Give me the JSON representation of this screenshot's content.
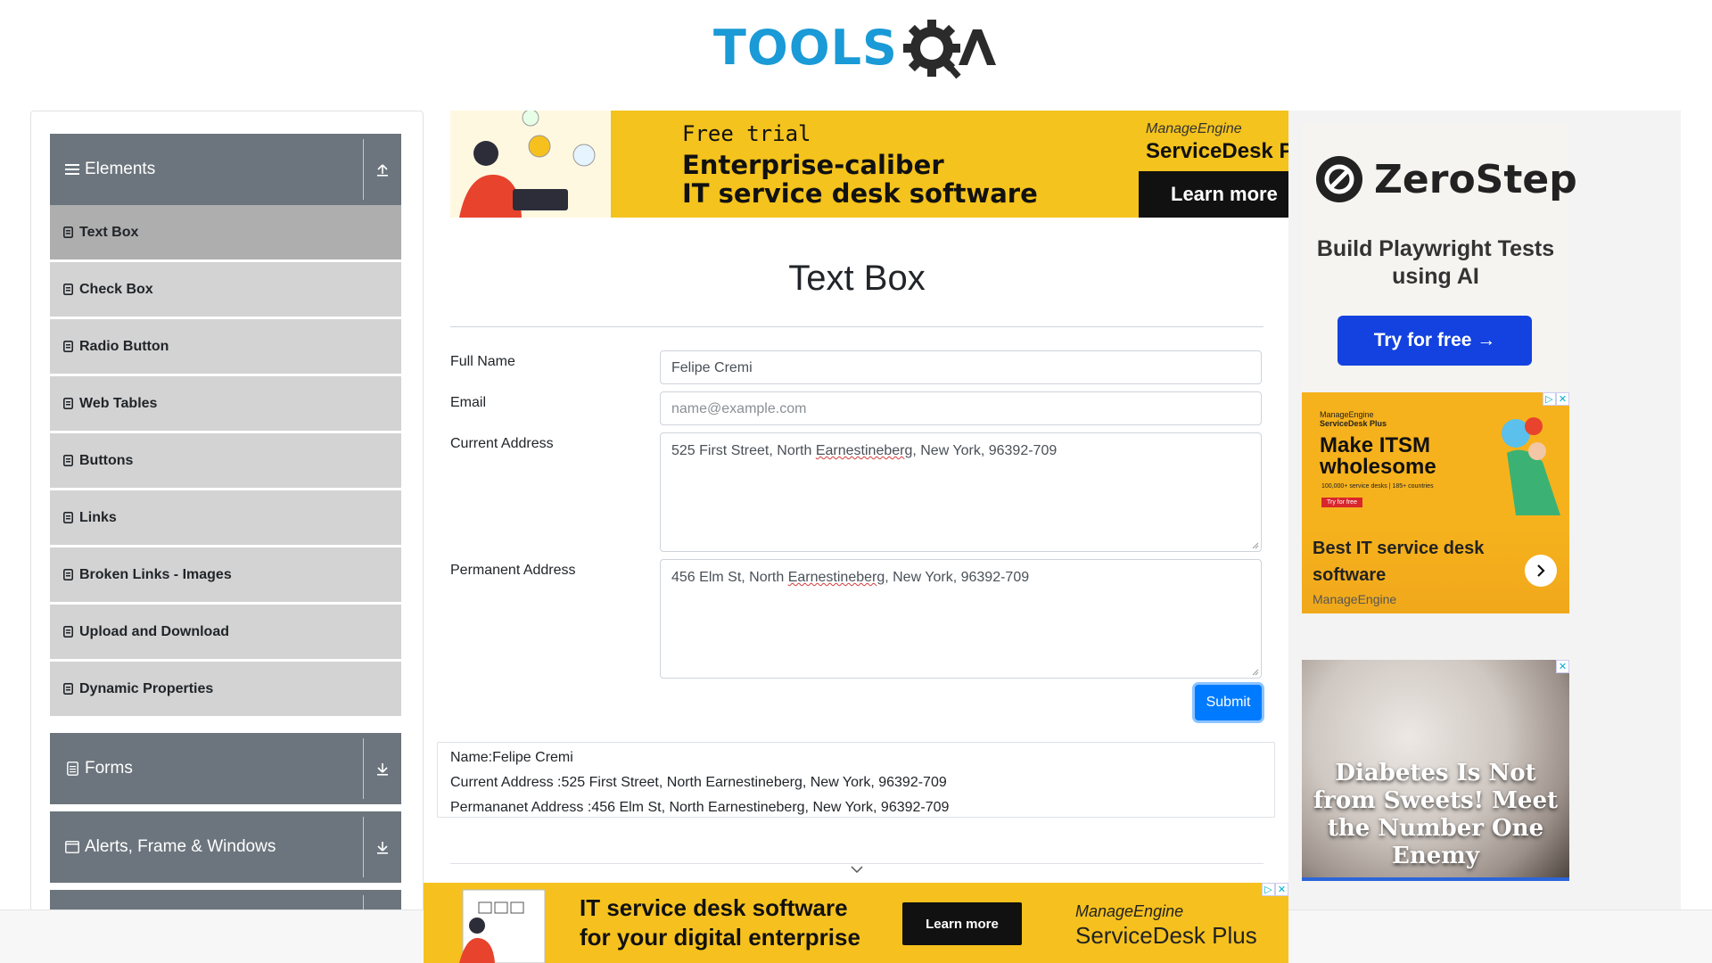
{
  "header": {
    "logo_text_part1": "TOOLS",
    "logo_text_part2": "QA"
  },
  "sidebar": {
    "groups": [
      {
        "label": "Elements",
        "icon": "hamburger-icon",
        "expanded": true
      },
      {
        "label": "Forms",
        "icon": "document-icon",
        "expanded": false
      },
      {
        "label": "Alerts, Frame & Windows",
        "icon": "window-icon",
        "expanded": false
      }
    ],
    "items": [
      {
        "label": "Text Box",
        "active": true
      },
      {
        "label": "Check Box"
      },
      {
        "label": "Radio Button"
      },
      {
        "label": "Web Tables"
      },
      {
        "label": "Buttons"
      },
      {
        "label": "Links"
      },
      {
        "label": "Broken Links - Images"
      },
      {
        "label": "Upload and Download"
      },
      {
        "label": "Dynamic Properties"
      }
    ]
  },
  "top_ad": {
    "line1": "Free trial",
    "line2": "Enterprise-caliber",
    "line3": "IT service desk software",
    "brand_small": "ManageEngine",
    "brand_large": "ServiceDesk Plus",
    "cta": "Learn more"
  },
  "main": {
    "title": "Text Box",
    "fields": {
      "full_name_label": "Full Name",
      "full_name_value": "Felipe Cremi",
      "email_label": "Email",
      "email_placeholder": "name@example.com",
      "current_address_label": "Current Address",
      "current_address_pre": "525 First Street, North ",
      "current_address_word": "Earnestineberg",
      "current_address_post": ", New York, 96392-709",
      "permanent_address_label": "Permanent Address",
      "permanent_address_pre": "456 Elm St, North ",
      "permanent_address_word": "Earnestineberg",
      "permanent_address_post": ", New York, 96392-709"
    },
    "submit_label": "Submit",
    "output": {
      "name": "Name:Felipe Cremi",
      "current": "Current Address :525 First Street, North Earnestineberg, New York, 96392-709",
      "permanent": "Permananet Address :456 Elm St, North Earnestineberg, New York, 96392-709"
    }
  },
  "right_ads": {
    "zerostep": {
      "name": "ZeroStep",
      "tagline": "Build Playwright Tests using AI",
      "cta": "Try for free →"
    },
    "itsm": {
      "brand_small": "ManageEngine",
      "brand_product": "ServiceDesk Plus",
      "headline": "Make ITSM wholesome",
      "stats": "100,000+ service desks | 185+ countries",
      "try": "Try for free",
      "title": "Best IT service desk software",
      "advertiser": "ManageEngine"
    },
    "diabetes": {
      "headline": "Diabetes Is Not from Sweets! Meet the Number One Enemy"
    }
  },
  "bottom_ad": {
    "line1": "IT service desk software",
    "line2": "for your digital enterprise",
    "cta": "Learn more",
    "brand_small": "ManageEngine",
    "brand_large": "ServiceDesk Plus"
  },
  "colors": {
    "logo_blue": "#1a9ad6",
    "sidebar_header": "#6c757d",
    "sidebar_item": "#d3d3d3",
    "sidebar_active": "#aeaeae",
    "submit": "#007bff",
    "ad_yellow": "#f4c31d",
    "zerostep_button": "#1342e0"
  }
}
